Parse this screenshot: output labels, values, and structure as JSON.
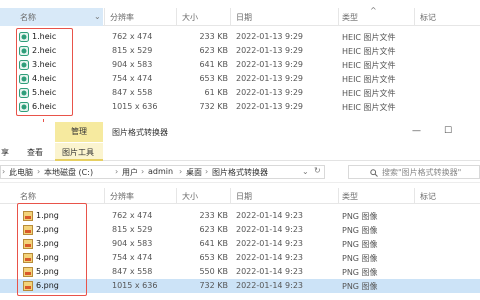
{
  "columns": {
    "name": "名称",
    "resolution": "分辨率",
    "size": "大小",
    "date": "日期",
    "type": "类型",
    "tag": "标记"
  },
  "heic_files": [
    {
      "name": "1.heic",
      "resolution": "762 x 474",
      "size": "233 KB",
      "date": "2022-01-13 9:29",
      "type": "HEIC 图片文件"
    },
    {
      "name": "2.heic",
      "resolution": "815 x 529",
      "size": "623 KB",
      "date": "2022-01-13 9:29",
      "type": "HEIC 图片文件"
    },
    {
      "name": "3.heic",
      "resolution": "904 x 583",
      "size": "641 KB",
      "date": "2022-01-13 9:29",
      "type": "HEIC 图片文件"
    },
    {
      "name": "4.heic",
      "resolution": "754 x 474",
      "size": "653 KB",
      "date": "2022-01-13 9:29",
      "type": "HEIC 图片文件"
    },
    {
      "name": "5.heic",
      "resolution": "847 x 558",
      "size": "61 KB",
      "date": "2022-01-13 9:29",
      "type": "HEIC 图片文件"
    },
    {
      "name": "6.heic",
      "resolution": "1015 x 636",
      "size": "732 KB",
      "date": "2022-01-13 9:29",
      "type": "HEIC 图片文件"
    }
  ],
  "ribbon": {
    "manage_tab": "管理",
    "title": "图片格式转换器",
    "tab_share": "享",
    "tab_view": "查看",
    "tab_picture_tools": "图片工具",
    "minimize": "—",
    "maximize": "☐"
  },
  "address": {
    "crumbs": [
      "此电脑",
      "本地磁盘 (C:)",
      "用户",
      "admin",
      "桌面",
      "图片格式转换器"
    ],
    "search_placeholder": "搜索\"图片格式转换器\""
  },
  "png_files": [
    {
      "name": "1.png",
      "resolution": "762 x 474",
      "size": "233 KB",
      "date": "2022-01-14 9:23",
      "type": "PNG 图像"
    },
    {
      "name": "2.png",
      "resolution": "815 x 529",
      "size": "623 KB",
      "date": "2022-01-14 9:23",
      "type": "PNG 图像"
    },
    {
      "name": "3.png",
      "resolution": "904 x 583",
      "size": "641 KB",
      "date": "2022-01-14 9:23",
      "type": "PNG 图像"
    },
    {
      "name": "4.png",
      "resolution": "754 x 474",
      "size": "653 KB",
      "date": "2022-01-14 9:23",
      "type": "PNG 图像"
    },
    {
      "name": "5.png",
      "resolution": "847 x 558",
      "size": "550 KB",
      "date": "2022-01-14 9:23",
      "type": "PNG 图像"
    },
    {
      "name": "6.png",
      "resolution": "1015 x 636",
      "size": "732 KB",
      "date": "2022-01-14 9:23",
      "type": "PNG 图像"
    }
  ],
  "colors": {
    "highlight_red": "#e8534a",
    "manage_yellow": "#f6ea9f",
    "selected_row": "#cce3f7",
    "heic_icon_green": "#2f9e7a"
  },
  "icons": {
    "heic_file": "heic-file-icon",
    "png_file": "png-image-icon",
    "search": "search-icon",
    "refresh": "refresh-icon",
    "chevron": "chevron-down-icon",
    "arrow": "down-arrow-icon"
  }
}
